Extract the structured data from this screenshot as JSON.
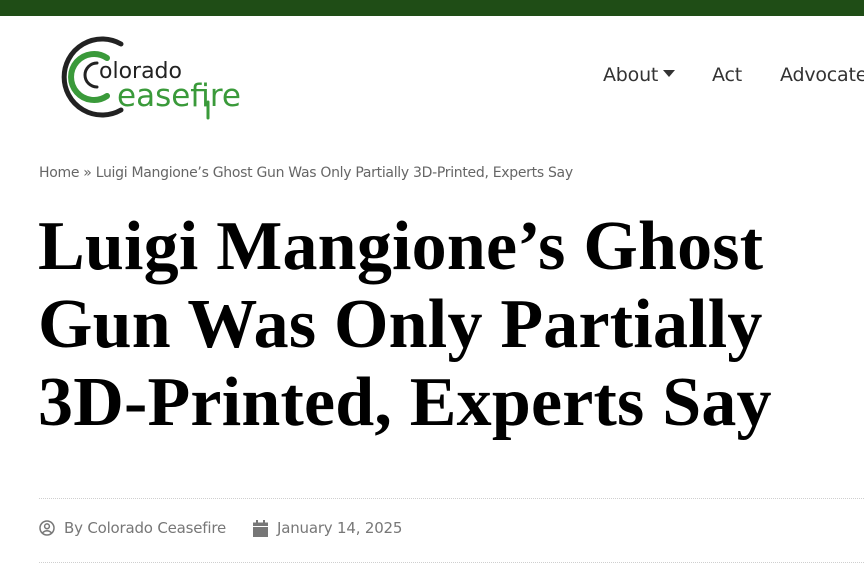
{
  "brand": {
    "logo_word1": "olorado",
    "logo_word2": "easefire",
    "logo_alt": "Colorado Ceasefire",
    "green": "#3a9a3a",
    "dark": "#222222",
    "topbar_color": "#1f4d16"
  },
  "nav": {
    "items": [
      {
        "label": "About",
        "has_dropdown": true
      },
      {
        "label": "Act",
        "has_dropdown": false
      },
      {
        "label": "Advocate",
        "has_dropdown": false
      }
    ]
  },
  "breadcrumb": {
    "home": "Home",
    "separator": " » ",
    "current": "Luigi Mangione’s Ghost Gun Was Only Partially 3D-Printed, Experts Say"
  },
  "article": {
    "title": "Luigi Mangione’s Ghost Gun Was Only Partially 3D-Printed, Experts Say",
    "author": "By Colorado Ceasefire",
    "date": "January 14, 2025",
    "author_icon": "user-circle-icon",
    "date_icon": "calendar-icon"
  }
}
